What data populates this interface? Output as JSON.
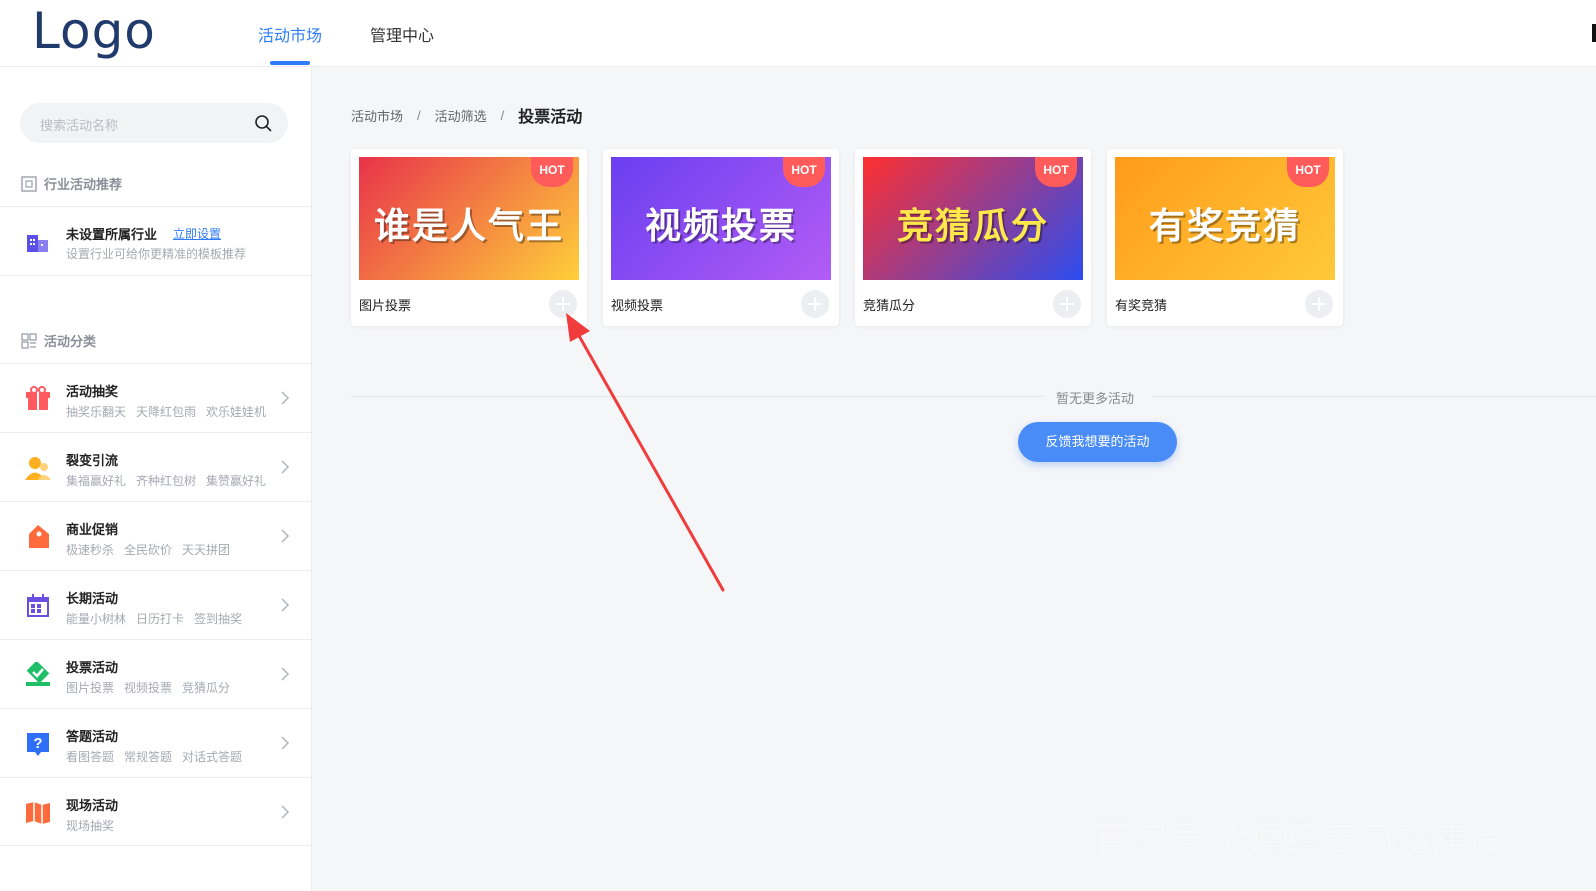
{
  "header": {
    "logo": "Logo",
    "tabs": [
      {
        "label": "活动市场",
        "active": true
      },
      {
        "label": "管理中心",
        "active": false
      }
    ],
    "accent_color": "#2f7cf6"
  },
  "sidebar": {
    "search": {
      "placeholder": "搜索活动名称",
      "icon": "search-icon"
    },
    "industry_section": {
      "title": "行业活动推荐",
      "item": {
        "title": "未设置所属行业",
        "link": "立即设置",
        "subtitle": "设置行业可给你更精准的模板推荐"
      }
    },
    "category_section": {
      "title": "活动分类",
      "items": [
        {
          "title": "活动抽奖",
          "subs": [
            "抽奖乐翻天",
            "天降红包雨",
            "欢乐娃娃机"
          ],
          "icon": "gift-icon",
          "color": "#ff5a5f"
        },
        {
          "title": "裂变引流",
          "subs": [
            "集福赢好礼",
            "齐种红包树",
            "集赞赢好礼"
          ],
          "icon": "users-icon",
          "color": "#ffb020"
        },
        {
          "title": "商业促销",
          "subs": [
            "极速秒杀",
            "全民砍价",
            "天天拼团"
          ],
          "icon": "tag-icon",
          "color": "#ff6b3d"
        },
        {
          "title": "长期活动",
          "subs": [
            "能量小树林",
            "日历打卡",
            "签到抽奖"
          ],
          "icon": "calendar-icon",
          "color": "#6b4fe0"
        },
        {
          "title": "投票活动",
          "subs": [
            "图片投票",
            "视频投票",
            "竞猜瓜分"
          ],
          "icon": "ballot-icon",
          "color": "#1fbf6a"
        },
        {
          "title": "答题活动",
          "subs": [
            "看图答题",
            "常规答题",
            "对话式答题"
          ],
          "icon": "question-icon",
          "color": "#2f6ef6"
        },
        {
          "title": "现场活动",
          "subs": [
            "现场抽奖"
          ],
          "icon": "map-icon",
          "color": "#ff6b3d"
        }
      ]
    }
  },
  "main": {
    "breadcrumb": [
      "活动市场",
      "活动筛选",
      "投票活动"
    ],
    "cards": [
      {
        "label": "图片投票",
        "thumb_text": "谁是人气王",
        "badge": "HOT",
        "bg": [
          "#e8324a",
          "#ffcf3a"
        ],
        "text_color": "#fff"
      },
      {
        "label": "视频投票",
        "thumb_text": "视频投票",
        "badge": "HOT",
        "bg": [
          "#6a3ff0",
          "#b35cf5"
        ],
        "text_color": "#fff"
      },
      {
        "label": "竞猜瓜分",
        "thumb_text": "竞猜瓜分",
        "badge": "HOT",
        "bg": [
          "#ff2f2f",
          "#2b4cf0"
        ],
        "text_color": "#ffe94a"
      },
      {
        "label": "有奖竞猜",
        "thumb_text": "有奖竞猜",
        "badge": "HOT",
        "bg": [
          "#ff9b1a",
          "#ffc93a"
        ],
        "text_color": "#fff"
      }
    ],
    "empty_text": "暂无更多活动",
    "feedback_button": "反馈我想要的活动"
  },
  "watermark": "百家号/太原码云网站建设"
}
